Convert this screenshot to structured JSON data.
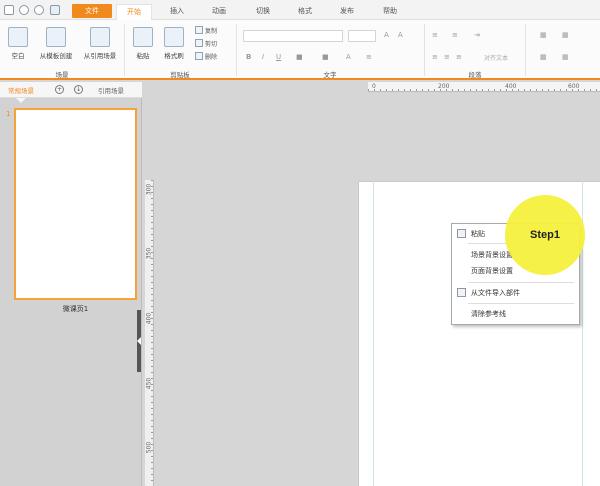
{
  "menu": {
    "tabs": [
      {
        "label": "文件"
      },
      {
        "label": "开始"
      },
      {
        "label": "插入"
      },
      {
        "label": "动画"
      },
      {
        "label": "切换"
      },
      {
        "label": "格式"
      },
      {
        "label": "发布"
      },
      {
        "label": "帮助"
      }
    ]
  },
  "ribbon": {
    "scene_group": {
      "label": "场景",
      "buttons": [
        "空白",
        "从模板创建",
        "从引用场景"
      ]
    },
    "clipboard_group": {
      "label": "剪贴板",
      "paste": "粘贴",
      "format_painter": "格式刷",
      "copy": "复制",
      "cut": "剪切",
      "delete": "删除"
    },
    "text_group": {
      "label": "文字"
    },
    "paragraph_group": {
      "label": "段落",
      "align_text": "对齐文本"
    }
  },
  "left_panel": {
    "tabs": [
      "常规场景",
      "引用场景"
    ],
    "slide_number": "1",
    "slide_caption": "微课页1"
  },
  "rulers": {
    "horizontal": [
      "0",
      "200",
      "400",
      "600"
    ],
    "vertical": [
      "300",
      "350",
      "400",
      "450",
      "500"
    ]
  },
  "context_menu": {
    "items": [
      "粘贴",
      "场景背景设置",
      "页面背景设置",
      "从文件导入部件",
      "清除参考线"
    ]
  },
  "annotation": {
    "label": "Step1"
  },
  "colors": {
    "accent": "#f08a1d",
    "highlight": "#f4f03c"
  }
}
